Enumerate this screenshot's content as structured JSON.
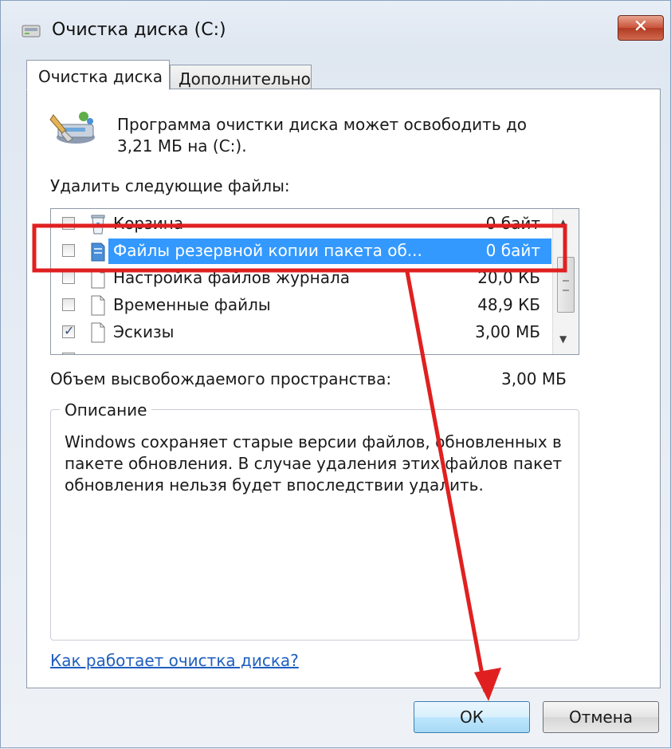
{
  "window": {
    "title": "Очистка диска  (C:)",
    "close_glyph": "✕"
  },
  "tabs": [
    {
      "label": "Очистка диска",
      "active": true
    },
    {
      "label": "Дополнительно",
      "active": false
    }
  ],
  "intro_text": "Программа очистки диска может освободить до 3,21 МБ на  (C:).",
  "list_label": "Удалить следующие файлы:",
  "files": [
    {
      "name": "Корзина",
      "size": "0 байт",
      "checked": false,
      "selected": false,
      "icon": "recycle-bin-icon"
    },
    {
      "name": "Файлы резервной копии пакета об...",
      "size": "0 байт",
      "checked": false,
      "selected": true,
      "icon": "backup-files-icon"
    },
    {
      "name": "Настройка файлов журнала",
      "size": "20,0 КБ",
      "checked": false,
      "selected": false,
      "icon": "file-icon"
    },
    {
      "name": "Временные файлы",
      "size": "48,9 КБ",
      "checked": false,
      "selected": false,
      "icon": "file-icon"
    },
    {
      "name": "Эскизы",
      "size": "3,00 МБ",
      "checked": true,
      "selected": false,
      "icon": "file-icon"
    }
  ],
  "total": {
    "label": "Объем высвобождаемого пространства:",
    "value": "3,00 МБ"
  },
  "description": {
    "title": "Описание",
    "text": "Windows сохраняет старые версии файлов, обновленных в пакете обновления. В случае удаления этих файлов пакет обновления нельзя будет впоследствии удалить."
  },
  "help_link": "Как работает очистка диска?",
  "buttons": {
    "ok": "ОК",
    "cancel": "Отмена"
  },
  "colors": {
    "selection": "#3399ff",
    "annotation": "#e02020",
    "link": "#1f5fbf"
  }
}
